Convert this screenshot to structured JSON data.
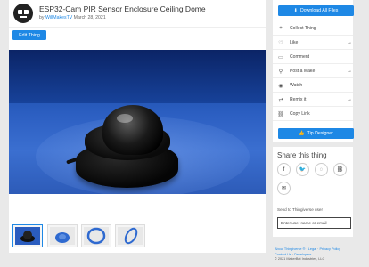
{
  "thing": {
    "title": "ESP32-Cam PIR Sensor Enclosure Ceiling Dome",
    "by_prefix": "by",
    "author": "WillMakesTV",
    "date": "March 28, 2021"
  },
  "edit_label": "Edit Thing",
  "sidebar": {
    "download_label": "Download All Files",
    "actions": [
      {
        "icon": "plus-icon",
        "label": "Collect Thing",
        "arrow": false
      },
      {
        "icon": "heart-icon",
        "label": "Like",
        "arrow": true
      },
      {
        "icon": "comment-icon",
        "label": "Comment",
        "arrow": false
      },
      {
        "icon": "make-icon",
        "label": "Post a Make",
        "arrow": true
      },
      {
        "icon": "eye-icon",
        "label": "Watch",
        "arrow": false
      },
      {
        "icon": "remix-icon",
        "label": "Remix it",
        "arrow": true
      },
      {
        "icon": "link-icon",
        "label": "Copy Link",
        "arrow": false
      }
    ],
    "tip_label": "Tip Designer"
  },
  "share": {
    "title": "Share this thing",
    "icons": [
      "facebook-icon",
      "twitter-icon",
      "whatsapp-icon",
      "link-icon",
      "email-icon"
    ],
    "send_label": "Send to Thingiverse user",
    "send_placeholder": "Enter user name or email"
  },
  "footer": {
    "about": "About Thingiverse ®",
    "legal": "Legal",
    "privacy": "Privacy Policy",
    "contact": "Contact Us",
    "developers": "Developers",
    "copyright": "© 2021 MakerBot Industries, LLC"
  }
}
